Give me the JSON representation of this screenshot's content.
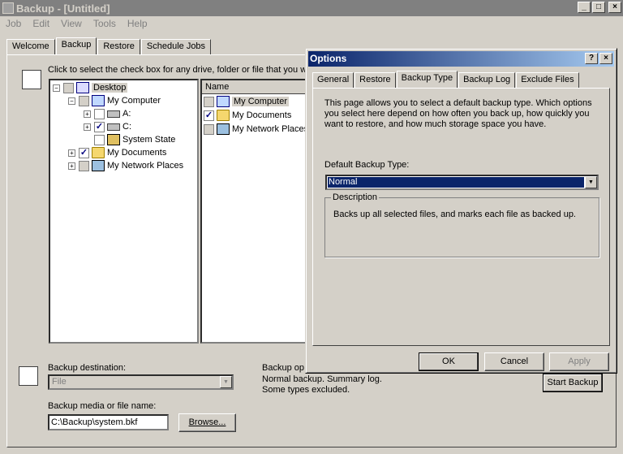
{
  "window": {
    "title": "Backup - [Untitled]",
    "min_glyph": "_",
    "max_glyph": "□",
    "close_glyph": "×"
  },
  "menu": [
    "Job",
    "Edit",
    "View",
    "Tools",
    "Help"
  ],
  "tabs": [
    "Welcome",
    "Backup",
    "Restore",
    "Schedule Jobs"
  ],
  "backup": {
    "instruction": "Click to select the check box for any drive, folder or file that you wa",
    "tree": [
      {
        "expander": "−",
        "check": "",
        "label": "Desktop"
      },
      {
        "expander": "−",
        "check": "",
        "label": "My Computer"
      },
      {
        "expander": "+",
        "check": "",
        "label": "A:"
      },
      {
        "expander": "+",
        "check": "✓",
        "label": "C:"
      },
      {
        "expander": "",
        "check": "",
        "label": "System State"
      },
      {
        "expander": "+",
        "check": "✓",
        "label": "My Documents"
      },
      {
        "expander": "+",
        "check": "",
        "label": "My Network Places"
      }
    ],
    "list_header": "Name",
    "list": [
      {
        "check": "",
        "label": "My Computer"
      },
      {
        "check": "✓",
        "label": "My Documents"
      },
      {
        "check": "",
        "label": "My Network Places"
      }
    ],
    "destination_label": "Backup destination:",
    "destination_value": "File",
    "media_label": "Backup media or file name:",
    "media_value": "C:\\Backup\\system.bkf",
    "browse_label": "Browse...",
    "options_lines": [
      "Backup op",
      "Normal backup.  Summary log.",
      "Some types excluded."
    ],
    "start_label": "Start Backup"
  },
  "dialog": {
    "title": "Options",
    "help_glyph": "?",
    "close_glyph": "×",
    "tabs": [
      "General",
      "Restore",
      "Backup Type",
      "Backup Log",
      "Exclude Files"
    ],
    "intro": "This page allows you to select a default backup type. Which options you select here depend on how often you back up, how quickly you want to restore, and how much storage space you have.",
    "type_label": "Default Backup Type:",
    "type_value": "Normal",
    "description_legend": "Description",
    "description_text": "Backs up all selected files, and marks each file as backed up.",
    "ok_label": "OK",
    "cancel_label": "Cancel",
    "apply_label": "Apply"
  },
  "colors": {
    "dialog_title_start": "#0a246a",
    "dialog_title_end": "#a6caf0",
    "inactive_title": "#808080",
    "face": "#d4d0c8"
  }
}
